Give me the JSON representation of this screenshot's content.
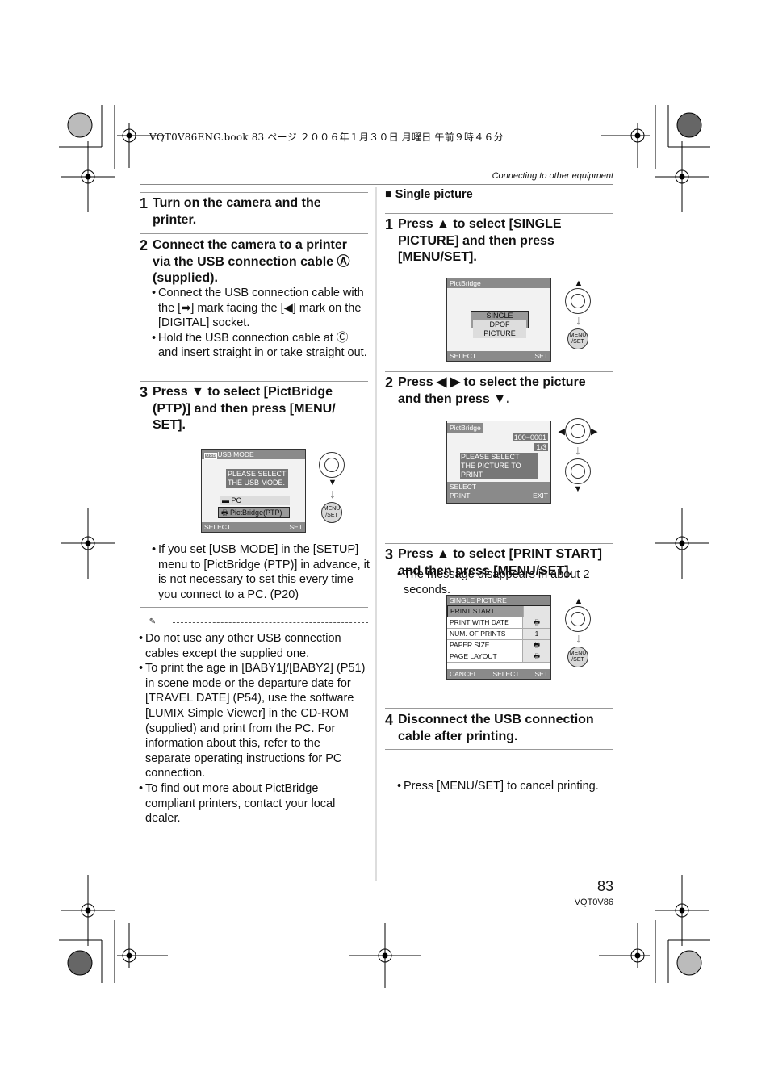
{
  "print_header": "VQT0V86ENG.book  83 ページ  ２００６年１月３０日  月曜日  午前９時４６分",
  "section_title": "Connecting to other equipment",
  "left": {
    "step1": {
      "num": "1",
      "text": "Turn on the camera and the printer."
    },
    "step2": {
      "num": "2",
      "text": "Connect the camera to a printer via the USB connection cable Ⓐ (supplied).",
      "bullets": [
        "Connect the USB connection cable with the [➡] mark facing the [◀] mark on the [DIGITAL] socket.",
        "Hold the USB connection cable at Ⓒ and insert straight in or take straight out."
      ]
    },
    "step3": {
      "num": "3",
      "text": "Press ▼ to select [PictBridge (PTP)] and then press [MENU/ SET].",
      "screen": {
        "title": "USB MODE",
        "title_icon": "USB",
        "message1": "PLEASE SELECT",
        "message2": "THE USB MODE.",
        "opt1": "PC",
        "opt2": "PictBridge(PTP)",
        "select": "SELECT",
        "set": "SET"
      },
      "note": "If you set [USB MODE] in the [SETUP] menu to [PictBridge (PTP)] in advance, it is not necessary to set this every time you connect to a PC. (P20)"
    },
    "notes": [
      "Do not use any other USB connection cables except the supplied one.",
      "To print the age in [BABY1]/[BABY2] (P51) in scene mode or the departure date for [TRAVEL DATE] (P54), use the software [LUMIX Simple Viewer] in the CD-ROM (supplied) and print from the PC. For information about this, refer to the separate operating instructions for PC connection.",
      "To find out more about PictBridge compliant printers, contact your local dealer."
    ]
  },
  "right": {
    "subhead": "Single picture",
    "step1": {
      "num": "1",
      "text": "Press ▲ to select [SINGLE PICTURE] and then press [MENU/SET].",
      "screen": {
        "title": "PictBridge",
        "opt1": "SINGLE PICTURE",
        "opt2": "DPOF PICTURE",
        "select": "SELECT",
        "set": "SET"
      }
    },
    "step2": {
      "num": "2",
      "text": "Press ◀ ▶ to select the picture and then press ▼.",
      "screen": {
        "title": "PictBridge",
        "file": "100−0001",
        "count": "1/3",
        "message1": "PLEASE SELECT",
        "message2": "THE PICTURE TO PRINT",
        "select": "SELECT",
        "print": "PRINT",
        "exit": "EXIT"
      },
      "note": "The message disappears in about 2 seconds."
    },
    "step3": {
      "num": "3",
      "text": "Press ▲ to select [PRINT START] and then press [MENU/SET].",
      "screen": {
        "title": "SINGLE PICTURE",
        "rows": [
          {
            "label": "PRINT START",
            "value": ""
          },
          {
            "label": "PRINT WITH DATE",
            "value": "🖶"
          },
          {
            "label": "NUM. OF PRINTS",
            "value": "1"
          },
          {
            "label": "PAPER SIZE",
            "value": "🖶"
          },
          {
            "label": "PAGE LAYOUT",
            "value": "🖶"
          }
        ],
        "cancel": "CANCEL",
        "select": "SELECT",
        "set": "SET"
      },
      "note": "Press [MENU/SET] to cancel printing."
    },
    "step4": {
      "num": "4",
      "text": "Disconnect the USB connection cable after printing."
    }
  },
  "menu_set_label": "MENU /SET",
  "page_number": "83",
  "model_code": "VQT0V86"
}
